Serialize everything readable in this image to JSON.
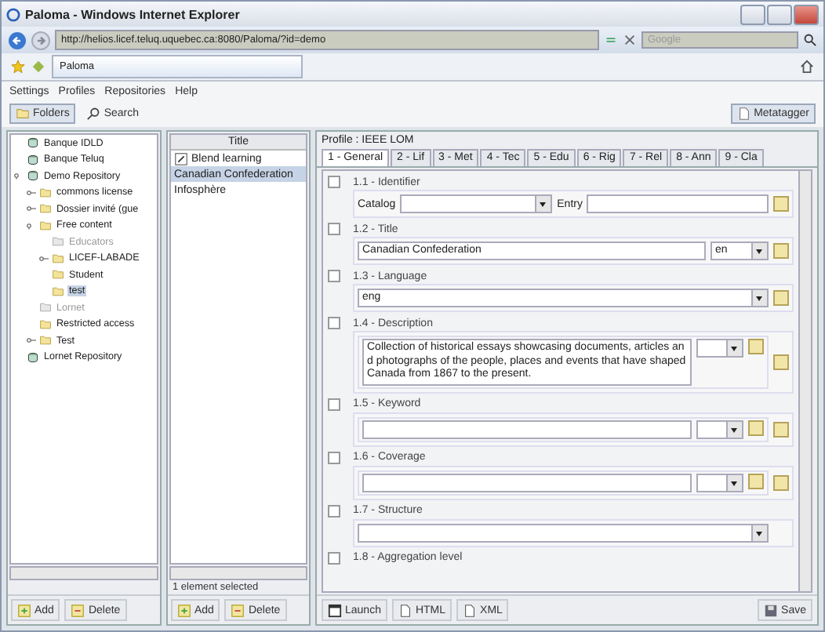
{
  "window": {
    "title": "Paloma - Windows Internet Explorer"
  },
  "address_bar": {
    "url": "http://helios.licef.teluq.uquebec.ca:8080/Paloma/?id=demo",
    "search_placeholder": "Google"
  },
  "browser_tab": {
    "label": "Paloma"
  },
  "menu": [
    "Settings",
    "Profiles",
    "Repositories",
    "Help"
  ],
  "toolbar": [
    {
      "label": "Folders",
      "kind": "folders",
      "selected": true
    },
    {
      "label": "Search",
      "kind": "search",
      "selected": false
    }
  ],
  "metatagger": {
    "label": "Metatagger"
  },
  "tree": [
    {
      "label": "Banque IDLD",
      "kind": "repository",
      "selected": false,
      "disabled": false
    },
    {
      "label": "Banque Teluq",
      "kind": "repository",
      "selected": false,
      "disabled": false
    },
    {
      "label": "Demo Repository",
      "kind": "repository",
      "selected": false,
      "disabled": false,
      "expanded": true,
      "children": [
        {
          "label": "commons  license",
          "kind": "folder",
          "selected": false,
          "disabled": false,
          "expanded": false
        },
        {
          "label": "Dossier invité (gue",
          "kind": "folder",
          "selected": false,
          "disabled": false,
          "expanded": false
        },
        {
          "label": "Free content",
          "kind": "folder",
          "selected": false,
          "disabled": false,
          "expanded": true,
          "children": [
            {
              "label": "Educators",
              "kind": "folder",
              "selected": false,
              "disabled": true
            },
            {
              "label": "LICEF-LABADE",
              "kind": "folder",
              "selected": false,
              "disabled": false,
              "expanded": false
            },
            {
              "label": "Student",
              "kind": "folder",
              "selected": false,
              "disabled": false
            },
            {
              "label": "test",
              "kind": "folder",
              "selected": true,
              "disabled": false
            }
          ]
        },
        {
          "label": "Lornet",
          "kind": "folder",
          "selected": false,
          "disabled": true
        },
        {
          "label": "Restricted access",
          "kind": "folder",
          "selected": false,
          "disabled": false
        },
        {
          "label": "Test",
          "kind": "folder",
          "selected": false,
          "disabled": false,
          "expanded": false
        }
      ]
    },
    {
      "label": "Lornet Repository",
      "kind": "repository",
      "selected": false,
      "disabled": false
    }
  ],
  "tree_buttons": [
    "Add",
    "Delete"
  ],
  "list": {
    "column": "Title",
    "items": [
      {
        "label": "Blend learning",
        "kind": "link",
        "selected": false
      },
      {
        "label": "Canadian Confederation",
        "kind": "plain",
        "selected": true
      },
      {
        "label": "Infosphère",
        "kind": "plain",
        "selected": false
      }
    ],
    "status": "1 element selected",
    "buttons": [
      "Add",
      "Delete"
    ]
  },
  "profile": {
    "label": "Profile : IEEE LOM",
    "tabs": [
      {
        "label": "1 - General",
        "selected": true
      },
      {
        "label": "2 - Lif",
        "selected": false
      },
      {
        "label": "3 - Met",
        "selected": false
      },
      {
        "label": "4 - Tec",
        "selected": false
      },
      {
        "label": "5 - Edu",
        "selected": false
      },
      {
        "label": "6 - Rig",
        "selected": false
      },
      {
        "label": "7 - Rel",
        "selected": false
      },
      {
        "label": "8 - Ann",
        "selected": false
      },
      {
        "label": "9 - Cla",
        "selected": false
      }
    ],
    "sections": [
      {
        "kind": "identifier",
        "label": "1.1 - Identifier",
        "catalog_label": "Catalog",
        "entry_label": "Entry"
      },
      {
        "kind": "langstring",
        "label": "1.2 - Title",
        "value": "Canadian Confederation",
        "lang": "en"
      },
      {
        "kind": "select",
        "label": "1.3 - Language",
        "value": "eng",
        "add": true
      },
      {
        "kind": "multi",
        "label": "1.4 - Description",
        "value": "Collection of historical essays showcasing documents, articles and photographs of the people, places and events that have shaped Canada from 1867 to the present."
      },
      {
        "kind": "multi",
        "label": "1.5 - Keyword"
      },
      {
        "kind": "multi",
        "label": "1.6 - Coverage"
      },
      {
        "kind": "select",
        "label": "1.7 - Structure",
        "add": false
      },
      {
        "kind": "header",
        "label": "1.8 - Aggregation level"
      }
    ]
  },
  "footer_buttons": [
    {
      "label": "Launch",
      "kind": "launch"
    },
    {
      "label": "HTML",
      "kind": "html"
    },
    {
      "label": "XML",
      "kind": "xml"
    }
  ],
  "save": "Save"
}
